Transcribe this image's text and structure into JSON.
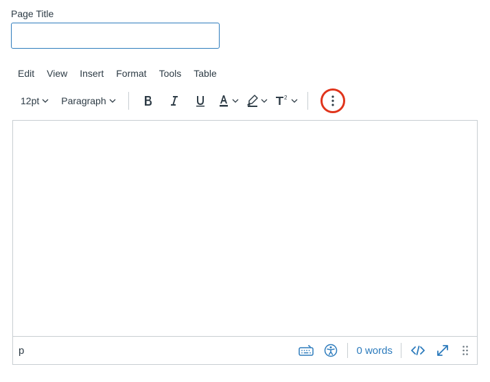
{
  "field_label": "Page Title",
  "title_value": "",
  "menubar": {
    "edit": "Edit",
    "view": "View",
    "insert": "Insert",
    "format": "Format",
    "tools": "Tools",
    "table": "Table"
  },
  "toolbar": {
    "font_size": "12pt",
    "block_format": "Paragraph"
  },
  "status": {
    "path": "p",
    "word_count": "0 words"
  }
}
